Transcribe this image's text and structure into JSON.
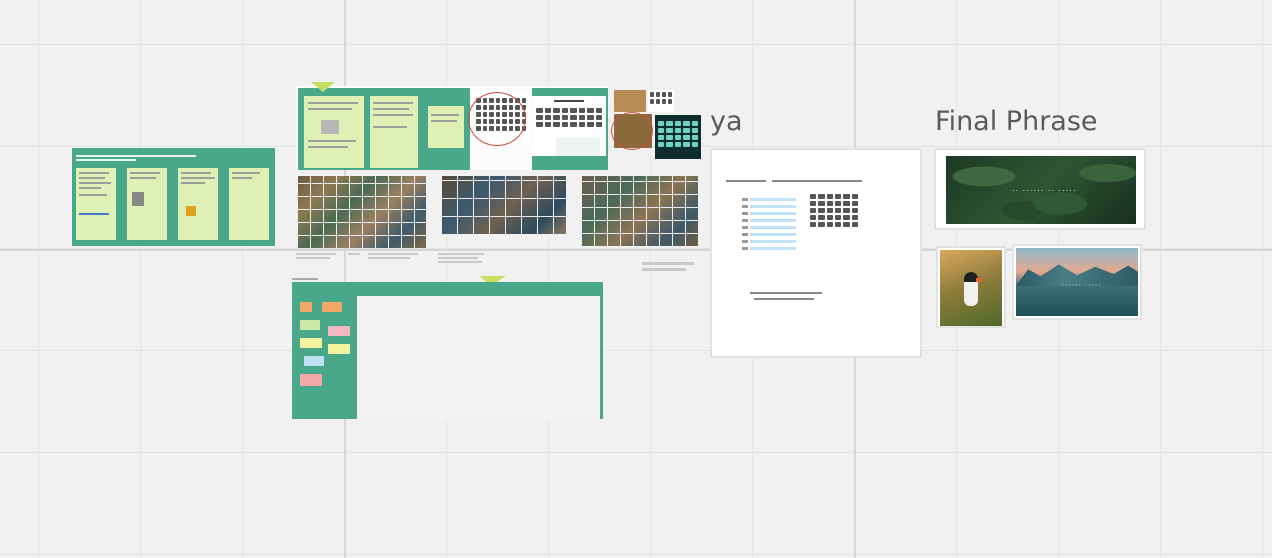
{
  "board": {
    "grid_visible": true,
    "background": "#f1f1f1"
  },
  "frames": {
    "ya": {
      "title": "ya"
    },
    "final_phrase": {
      "title": "Final Phrase",
      "banner_caption": "·· ······ ·· ·····",
      "landscape_caption": "······ ·····"
    }
  },
  "colors": {
    "frame_green": "#4aa88a",
    "sticky_lime": "#dff0b4",
    "arrow_lime": "#c6e060",
    "annotation_red": "#d24a3c",
    "highlight_blue": "#bfe0f5",
    "dark_panel": "#0e2d2e"
  },
  "icons": [
    "arrow-marker-icon"
  ]
}
